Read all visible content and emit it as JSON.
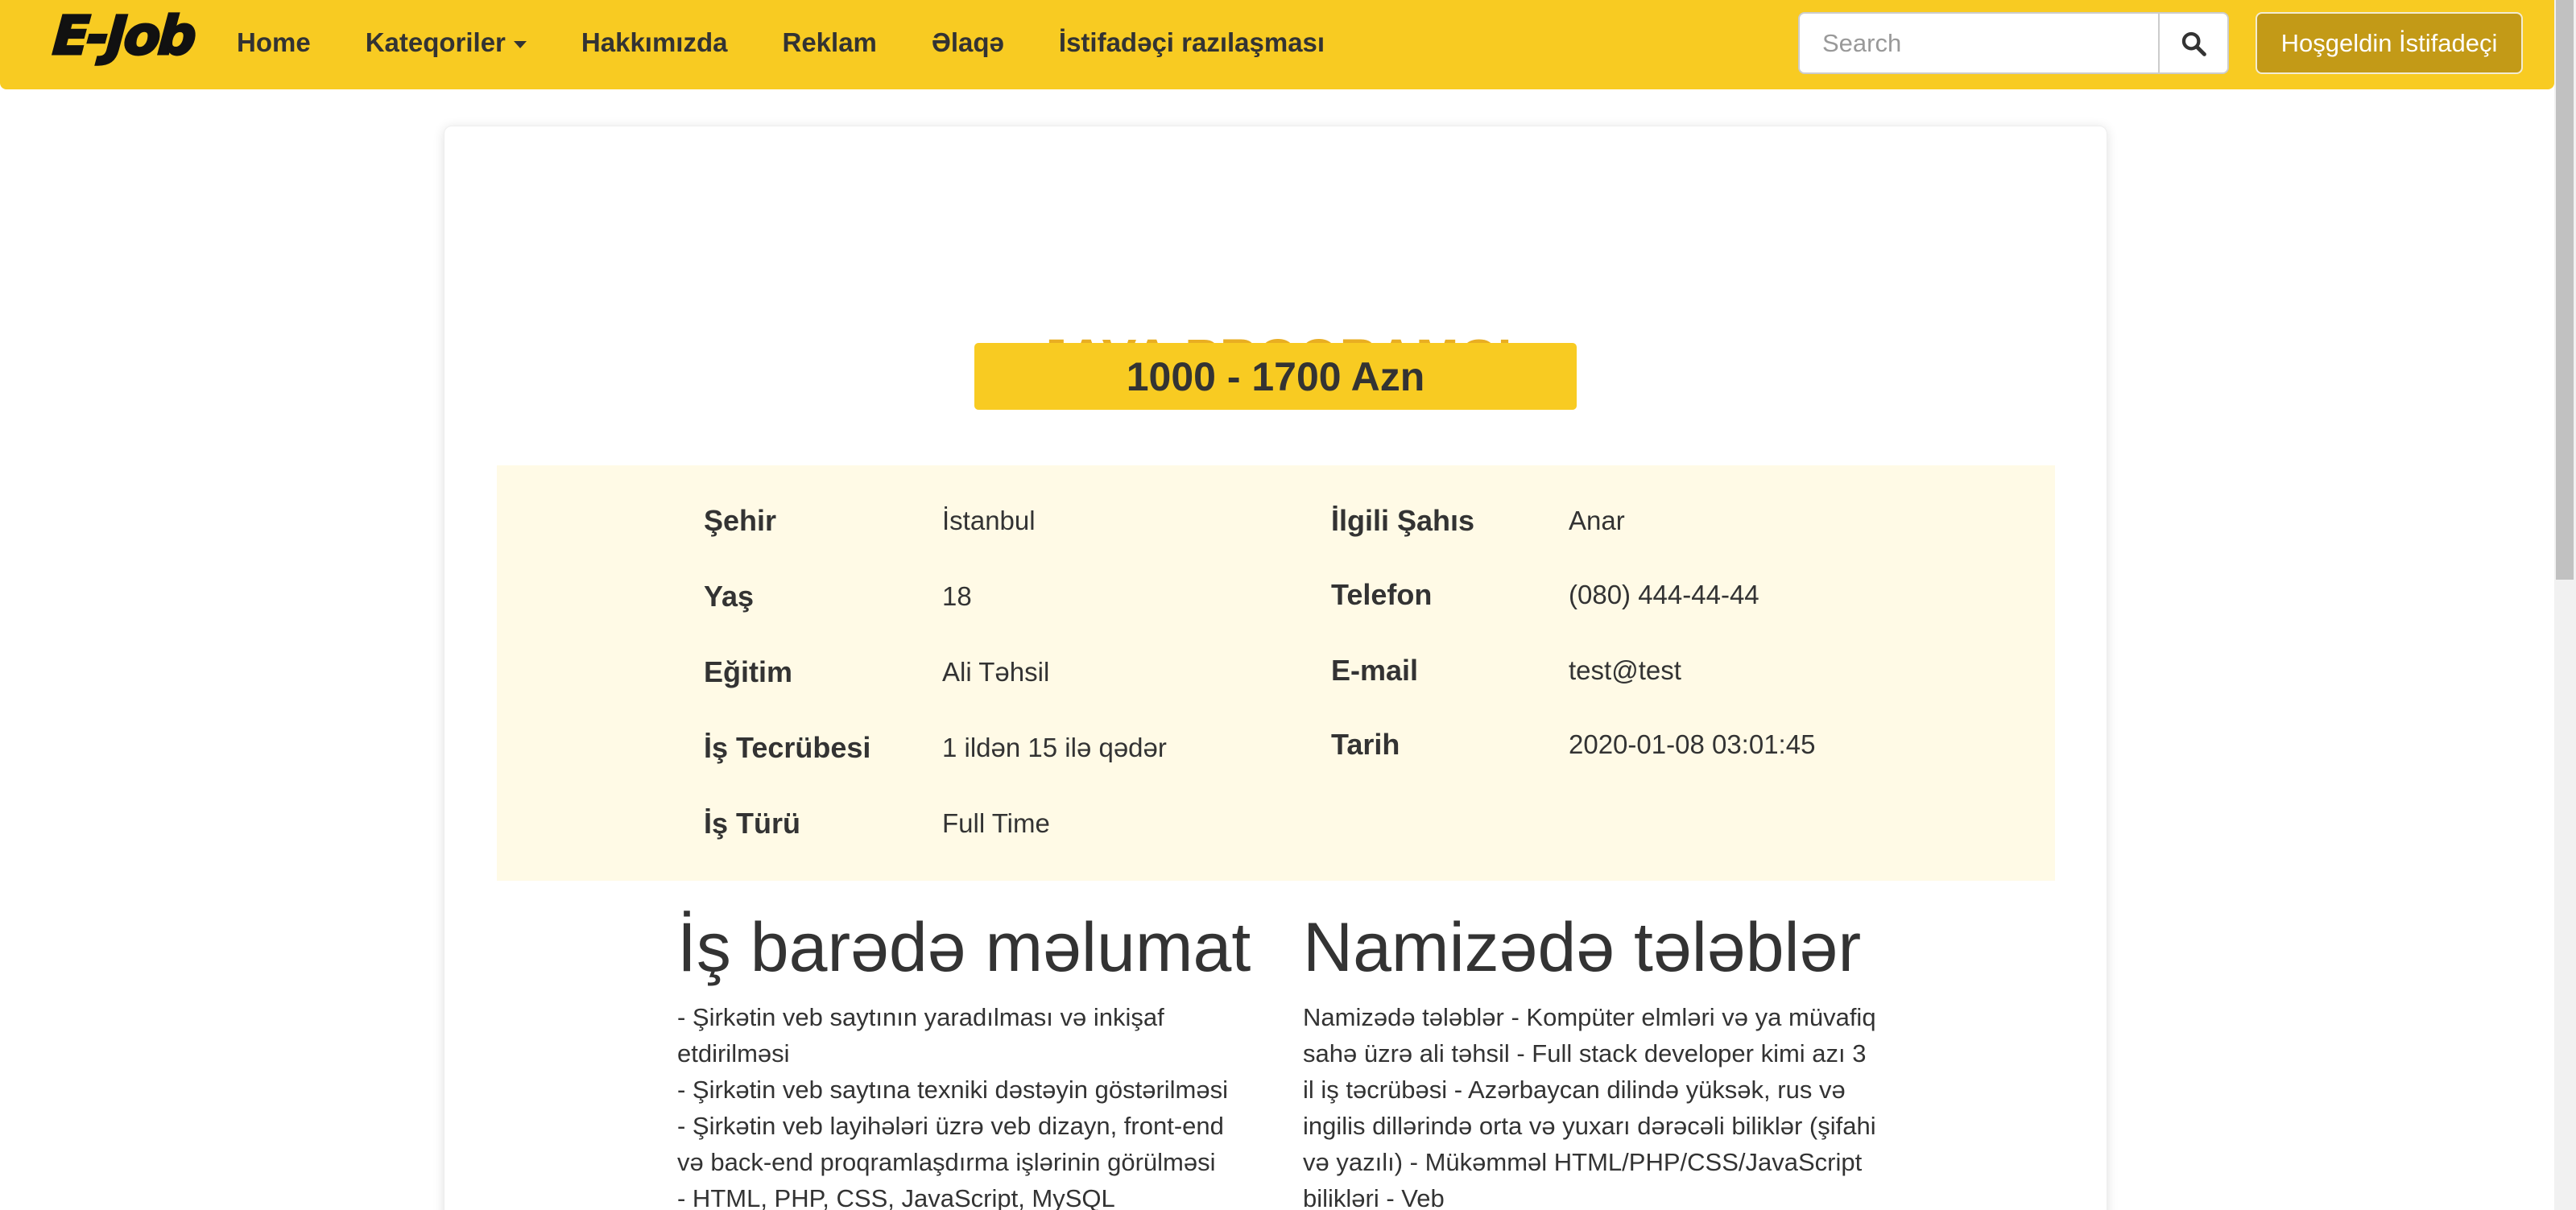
{
  "nav": {
    "brand": "E-Job",
    "links": [
      "Home",
      "Kateqoriler",
      "Hakkımızda",
      "Reklam",
      "Əlaqə",
      "İstifadəçi razılaşması"
    ],
    "search_placeholder": "Search",
    "welcome_label": "Hoşgeldin İstifadeçi"
  },
  "job": {
    "title": "JAVA PROQRAMÇI",
    "salary": "1000 - 1700 Azn",
    "details_left": [
      {
        "label": "Şehir",
        "value": "İstanbul"
      },
      {
        "label": "Yaş",
        "value": "18"
      },
      {
        "label": "Eğitim",
        "value": "Ali Təhsil"
      },
      {
        "label": "İş Tecrübesi",
        "value": "1 ildən 15 ilə qədər"
      },
      {
        "label": "İş Türü",
        "value": "Full Time"
      }
    ],
    "details_right": [
      {
        "label": "İlgili Şahıs",
        "value": "Anar"
      },
      {
        "label": "Telefon",
        "value": "(080) 444-44-44"
      },
      {
        "label": "E-mail",
        "value": "test@test"
      },
      {
        "label": "Tarih",
        "value": "2020-01-08 03:01:45"
      }
    ]
  },
  "about": {
    "heading": "İş barədə məlumat",
    "text": "- Şirkətin veb saytının yaradılması və inkişaf etdirilməsi\n- Şirkətin veb saytına texniki dəstəyin göstərilməsi\n- Şirkətin veb layihələri üzrə veb dizayn, front-end və back-end proqramlaşdırma işlərinin görülməsi\n- HTML, PHP, CSS, JavaScript, MySQL"
  },
  "requirements": {
    "heading": "Namizədə tələblər",
    "text": "Namizədə tələblər - Kompüter elmləri və ya müvafiq sahə üzrə ali təhsil - Full stack developer kimi azı 3 il iş təcrübəsi - Azərbaycan dilində yüksək, rus və ingilis dillərində orta və yuxarı dərəcəli biliklər (şifahi və yazılı) - Mükəmməl HTML/PHP/CSS/JavaScript bilikləri - Veb"
  }
}
